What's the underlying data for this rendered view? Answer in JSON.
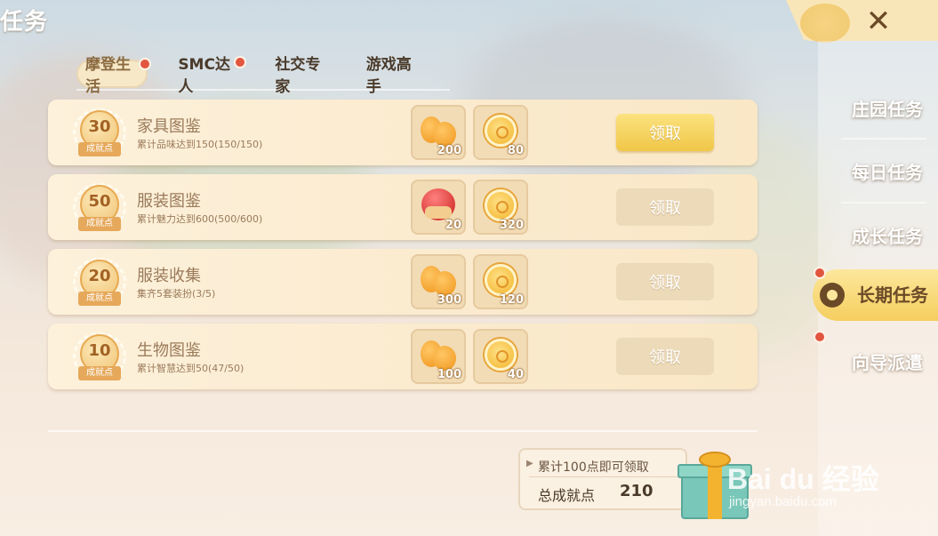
{
  "page_title": "任务",
  "subtabs": [
    {
      "label": "摩登生活",
      "active": true,
      "has_dot": true
    },
    {
      "label": "SMC达人",
      "active": false,
      "has_dot": true
    },
    {
      "label": "社交专家",
      "active": false,
      "has_dot": false
    },
    {
      "label": "游戏高手",
      "active": false,
      "has_dot": false
    }
  ],
  "badge_caption": "成就点",
  "tasks": [
    {
      "points": "30",
      "title": "家具图鉴",
      "desc": "累计品味达到150(150/150)",
      "rewards": [
        {
          "icon": "orange-icon",
          "qty": "200"
        },
        {
          "icon": "coin-icon",
          "qty": "80"
        }
      ],
      "button": "领取",
      "claimable": true
    },
    {
      "points": "50",
      "title": "服装图鉴",
      "desc": "累计魅力达到600(500/600)",
      "rewards": [
        {
          "icon": "fruit-icon",
          "qty": "20"
        },
        {
          "icon": "coin-icon",
          "qty": "320"
        }
      ],
      "button": "领取",
      "claimable": false
    },
    {
      "points": "20",
      "title": "服装收集",
      "desc": "集齐5套装扮(3/5)",
      "rewards": [
        {
          "icon": "orange-icon",
          "qty": "300"
        },
        {
          "icon": "coin-icon",
          "qty": "120"
        }
      ],
      "button": "领取",
      "claimable": false
    },
    {
      "points": "10",
      "title": "生物图鉴",
      "desc": "累计智慧达到50(47/50)",
      "rewards": [
        {
          "icon": "orange-icon",
          "qty": "100"
        },
        {
          "icon": "coin-icon",
          "qty": "40"
        }
      ],
      "button": "领取",
      "claimable": false
    }
  ],
  "summary": {
    "tip": "累计100点即可领取",
    "total_label": "总成就点",
    "total_value": "210"
  },
  "close_icon": "close-icon",
  "right_nav": [
    {
      "label": "庄园任务",
      "active": false,
      "has_dot": false
    },
    {
      "label": "每日任务",
      "active": false,
      "has_dot": false
    },
    {
      "label": "成长任务",
      "active": false,
      "has_dot": false
    },
    {
      "label": "长期任务",
      "active": true,
      "has_dot": true
    },
    {
      "label": "向导派遣",
      "active": false,
      "has_dot": true
    }
  ],
  "watermark": {
    "brand": "Bai du 经验",
    "url": "jingyan.baidu.com"
  },
  "colors": {
    "claim_ready": "#f0c748",
    "claim_disabled": "#ecdab9",
    "dot": "#e2553f",
    "nav_active": "#f5ce5e"
  }
}
